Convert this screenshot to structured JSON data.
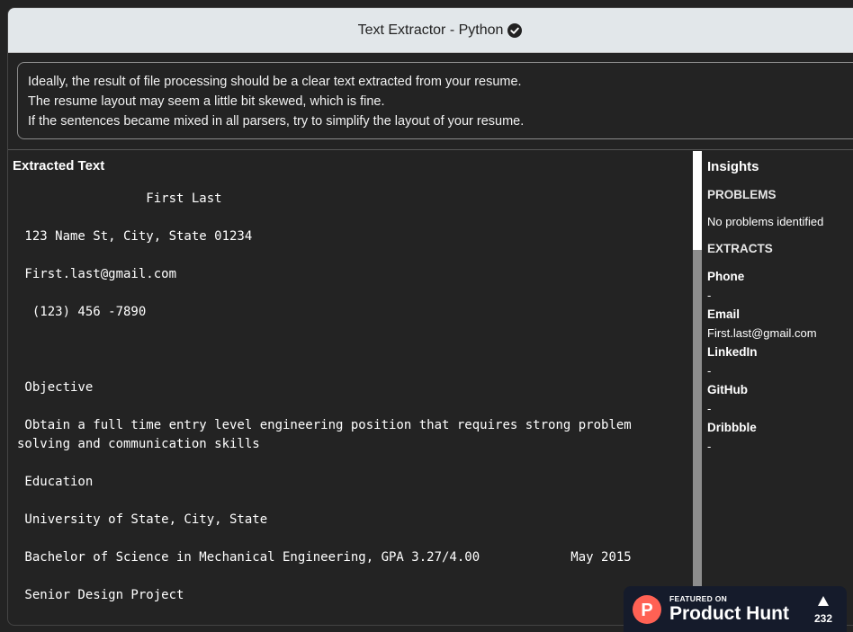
{
  "window": {
    "title": "Text Extractor - Python",
    "verified_icon": "check-circle-icon"
  },
  "notice": {
    "lines": [
      "Ideally, the result of file processing should be a clear text extracted from your resume.",
      "The resume layout may seem a little bit skewed, which is fine.",
      "If the sentences became mixed in all parsers, try to simplify the layout of your resume."
    ]
  },
  "extracted": {
    "title": "Extracted Text",
    "text": "                 First Last\n\n 123 Name St, City, State 01234\n\n First.last@gmail.com\n\n  (123) 456 -7890\n\n\n\n Objective\n\n Obtain a full time entry level engineering position that requires strong problem\nsolving and communication skills\n\n Education\n\n University of State, City, State\n\n Bachelor of Science in Mechanical Engineering, GPA 3.27/4.00            May 2015\n\n Senior Design Project"
  },
  "insights": {
    "title": "Insights",
    "problems_heading": "PROBLEMS",
    "problems_text": "No problems identified",
    "extracts_heading": "EXTRACTS",
    "fields": [
      {
        "label": "Phone",
        "value": "-"
      },
      {
        "label": "Email",
        "value": "First.last@gmail.com"
      },
      {
        "label": "LinkedIn",
        "value": "-"
      },
      {
        "label": "GitHub",
        "value": "-"
      },
      {
        "label": "Dribbble",
        "value": "-"
      }
    ]
  },
  "product_hunt": {
    "featured": "FEATURED ON",
    "name": "Product Hunt",
    "logo_letter": "P",
    "votes": "232",
    "upvote_icon": "triangle-up-icon"
  },
  "colors": {
    "background": "#232323",
    "titlebar": "#e2e7ea",
    "product_hunt_orange": "#ff6154",
    "product_hunt_bg": "#151b2b"
  }
}
